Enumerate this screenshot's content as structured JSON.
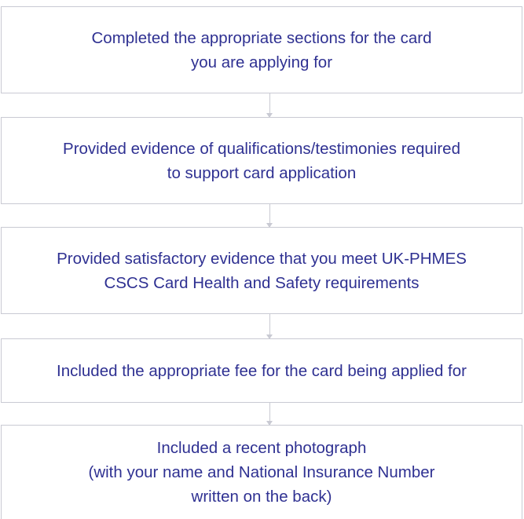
{
  "colors": {
    "text": "#2f3192",
    "border": "#c9cad3",
    "background": "#ffffff"
  },
  "steps": [
    "Completed the appropriate sections for the card\nyou are applying for",
    "Provided evidence of qualifications/testimonies required\nto support card application",
    "Provided satisfactory evidence that you meet UK-PHMES\nCSCS Card Health and Safety requirements",
    "Included the appropriate fee for the card being applied for",
    "Included a recent photograph\n(with your name and National Insurance Number\nwritten on the back)"
  ],
  "connector_icon": "down-arrow-icon"
}
